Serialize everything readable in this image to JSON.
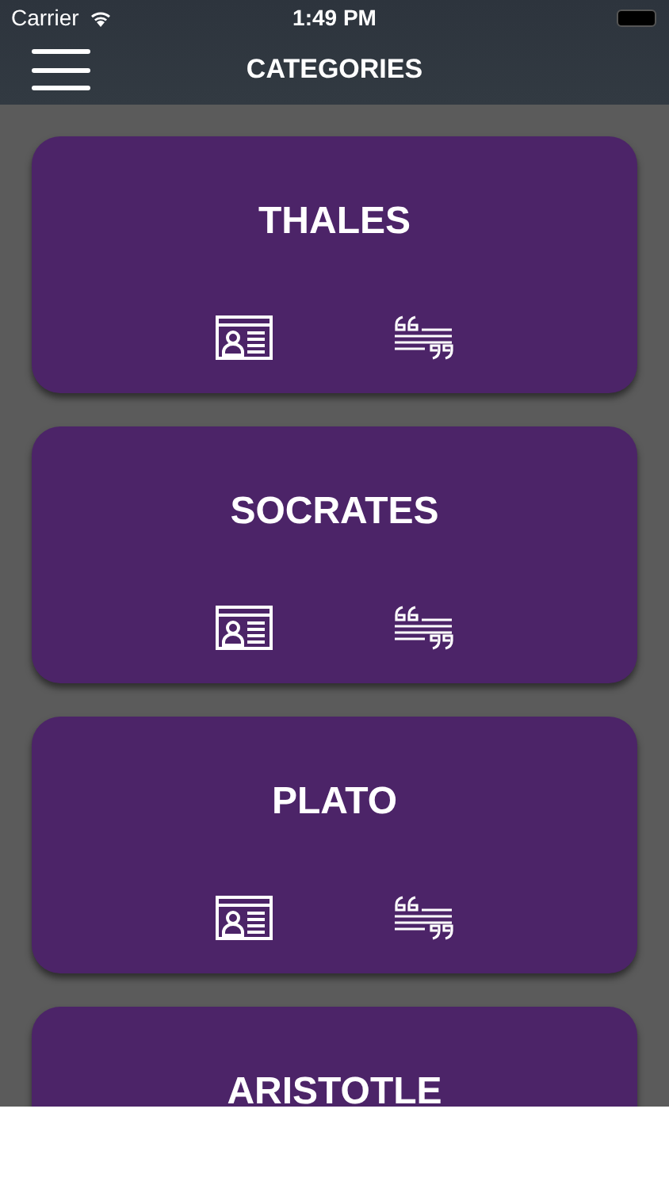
{
  "status_bar": {
    "carrier": "Carrier",
    "time": "1:49 PM"
  },
  "nav": {
    "title": "CATEGORIES"
  },
  "categories": [
    {
      "name": "THALES"
    },
    {
      "name": "SOCRATES"
    },
    {
      "name": "PLATO"
    },
    {
      "name": "ARISTOTLE"
    }
  ]
}
